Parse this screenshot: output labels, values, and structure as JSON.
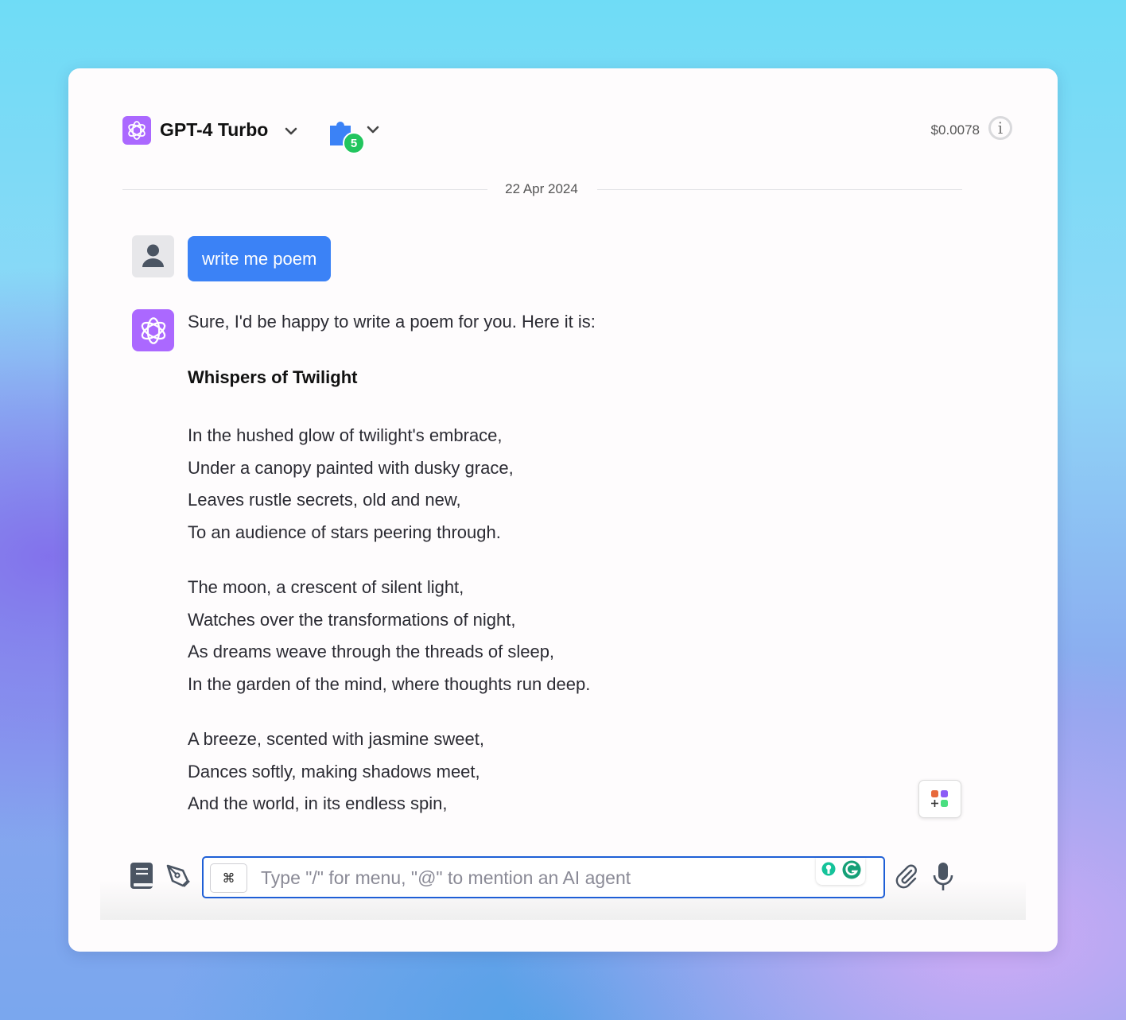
{
  "header": {
    "model_name": "GPT-4 Turbo",
    "plugin_count": "5",
    "cost": "$0.0078",
    "info_symbol": "i"
  },
  "chat": {
    "date_separator": "22 Apr 2024",
    "user_message": "write me poem",
    "ai_intro": "Sure, I'd be happy to write a poem for you. Here it is:",
    "poem_title": "Whispers of Twilight",
    "stanzas": [
      [
        "In the hushed glow of twilight's embrace,",
        "Under a canopy painted with dusky grace,",
        "Leaves rustle secrets, old and new,",
        "To an audience of stars peering through."
      ],
      [
        "The moon, a crescent of silent light,",
        "Watches over the transformations of night,",
        "As dreams weave through the threads of sleep,",
        "In the garden of the mind, where thoughts run deep."
      ],
      [
        "A breeze, scented with jasmine sweet,",
        "Dances softly, making shadows meet,",
        "And the world, in its endless spin,"
      ]
    ]
  },
  "composer": {
    "shortcut_key": "⌘",
    "placeholder": "Type \"/\" for menu, \"@\" to mention an AI agent"
  },
  "colors": {
    "accent_blue": "#3b82f6",
    "model_purple": "#ab68ff",
    "badge_green": "#22c55e",
    "input_border": "#1e5fd6"
  }
}
